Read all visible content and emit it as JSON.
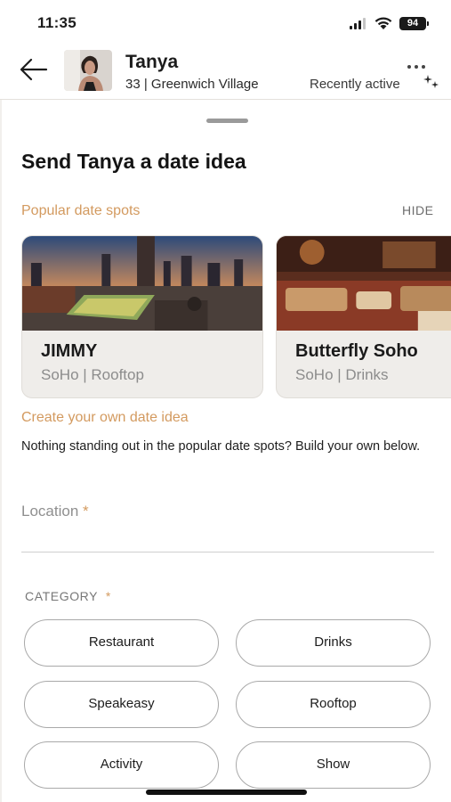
{
  "status_bar": {
    "time": "11:35",
    "battery": "94",
    "icons": [
      "signal-icon",
      "wifi-icon",
      "battery-icon"
    ]
  },
  "header": {
    "name": "Tanya",
    "age": "33",
    "neighborhood": "Greenwich Village",
    "subline": "33 | Greenwich Village",
    "activity": "Recently active",
    "icons": [
      "back-arrow-icon",
      "more-icon",
      "sparkle-icon"
    ]
  },
  "sheet": {
    "title": "Send Tanya a date idea",
    "popular_label": "Popular date spots",
    "hide_label": "HIDE",
    "spots": [
      {
        "name": "JIMMY",
        "subtitle": "SoHo | Rooftop"
      },
      {
        "name": "Butterfly Soho",
        "subtitle": "SoHo | Drinks"
      }
    ],
    "create_label": "Create your own date idea",
    "helper_text": "Nothing standing out in the popular date spots? Build your own below.",
    "location": {
      "label": "Location",
      "required_mark": "*",
      "value": ""
    },
    "category": {
      "label": "CATEGORY",
      "required_mark": "*",
      "options": [
        "Restaurant",
        "Drinks",
        "Speakeasy",
        "Rooftop",
        "Activity",
        "Show"
      ]
    }
  },
  "colors": {
    "accent": "#d39a5f",
    "text": "#1c1c1c",
    "muted": "#8c8c8c",
    "card_bg": "#efedea"
  }
}
